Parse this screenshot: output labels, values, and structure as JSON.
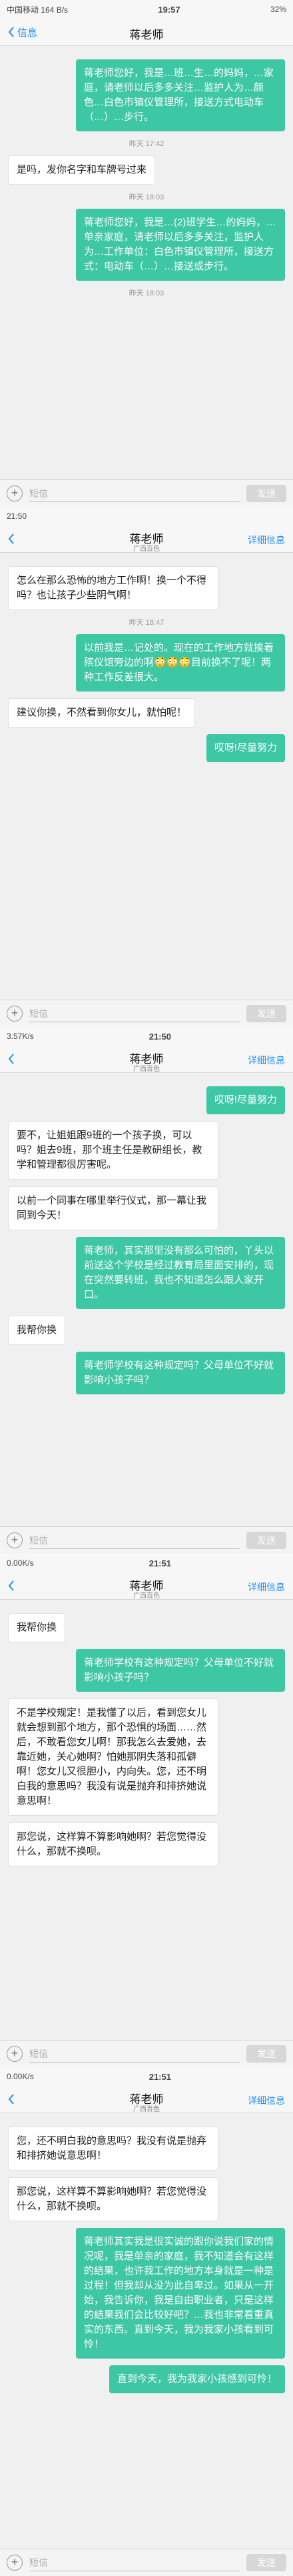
{
  "s1": {
    "status": {
      "left": "中国移动 164 B/s",
      "time": "19:57",
      "battery": "32%"
    },
    "back": "信息",
    "title": "蒋老师",
    "msgs": [
      {
        "dir": "out",
        "text": "蒋老师您好，我是…班…生…的妈妈，…家庭，请老师以后多多关注…监护人为…颜色…白色市镇仪管理所，接送方式电动车（…）…步行。"
      },
      {
        "dir": "ts",
        "text": "昨天 17:42"
      },
      {
        "dir": "in",
        "text": "是吗，发你名字和车牌号过来"
      },
      {
        "dir": "ts",
        "text": "昨天 18:03"
      },
      {
        "dir": "out",
        "text": "蒋老师您好，我是…(2)班学生…的妈妈，…单亲家庭，请老师以后多多关注，监护人为…工作单位：白色市镇仪管理所，接送方式：电动车（…）…接送或步行。"
      },
      {
        "dir": "ts",
        "text": "昨天 18:03"
      }
    ],
    "input_placeholder": "短信",
    "send": "发送"
  },
  "s2": {
    "status": {
      "left": "21:50"
    },
    "title": "蒋老师",
    "sub": "广西百色",
    "detail": "详细信息",
    "msgs": [
      {
        "dir": "in",
        "text": "怎么在那么恐怖的地方工作啊！换一个不得吗？也让孩子少些阴气啊！"
      },
      {
        "dir": "ts",
        "text": "昨天 18:47"
      },
      {
        "dir": "out",
        "text": "以前我是…记处的。现在的工作地方就挨着殡仪馆旁边的啊😳😳😳目前换不了呢！两种工作反差很大。"
      },
      {
        "dir": "in",
        "text": "建议你换，不然看到你女儿，就怕呢！"
      },
      {
        "dir": "out",
        "text": "哎呀!尽量努力"
      }
    ],
    "input_placeholder": "短信",
    "send": "发送"
  },
  "s3": {
    "status": {
      "left": "3.57K/s",
      "time": "21:50"
    },
    "title": "蒋老师",
    "sub": "广西百色",
    "detail": "详细信息",
    "msgs": [
      {
        "dir": "out",
        "text": "哎呀!尽量努力"
      },
      {
        "dir": "in",
        "text": "要不，让姐姐跟9班的一个孩子换，可以吗？姐去9班，那个班主任是教研组长，教学和管理都很厉害呢。"
      },
      {
        "dir": "in",
        "text": "以前一个同事在哪里举行仪式，那一幕让我同到今天！"
      },
      {
        "dir": "out",
        "text": "蒋老师，其实那里没有那么可怕的，丫头以前送这个学校是经过教育局里面安排的，现在突然要转班，我也不知道怎么跟人家开口。"
      },
      {
        "dir": "in",
        "text": "我帮你换"
      },
      {
        "dir": "out",
        "text": "蒋老师学校有这种规定吗？父母单位不好就影响小孩子吗？"
      }
    ],
    "input_placeholder": "短信",
    "send": "发送"
  },
  "s4": {
    "status": {
      "left": "0.00K/s",
      "time": "21:51"
    },
    "title": "蒋老师",
    "sub": "广西百色",
    "detail": "详细信息",
    "msgs": [
      {
        "dir": "in",
        "text": "我帮你换"
      },
      {
        "dir": "out",
        "text": "蒋老师学校有这种规定吗？父母单位不好就影响小孩子吗？"
      },
      {
        "dir": "in",
        "text": "不是学校规定！是我懂了以后，看到您女儿就会想到那个地方，那个恐惧的场面……然后，不敢看您女儿啊！那我怎么去爱她，去靠近她，关心她啊？怕她那阴失落和孤僻啊！您女儿又很胆小，内向失。您，还不明白我的意思吗？我没有说是抛弃和排挤她说意思啊！"
      },
      {
        "dir": "in",
        "text": "那您说，这样算不算影响她啊？若您觉得没什么，那就不换呗。"
      }
    ],
    "input_placeholder": "短信",
    "send": "发送"
  },
  "s5": {
    "status": {
      "left": "0.00K/s",
      "time": "21:51"
    },
    "title": "蒋老师",
    "sub": "广西百色",
    "detail": "详细信息",
    "msgs": [
      {
        "dir": "in",
        "text": "您，还不明白我的意思吗？我没有说是抛弃和排挤她说意思啊！"
      },
      {
        "dir": "in",
        "text": "那您说，这样算不算影响她啊？若您觉得没什么，那就不换呗。"
      },
      {
        "dir": "out",
        "text": "蒋老师其实我是很实诚的跟你说我们家的情况呢，我是单亲的家庭，我不知道会有这样的结果，也许我工作的地方本身就是一种是过程！但我却从没为此自卑过。如果从一开始，我告诉你，我是自由职业者，只是这样的结果我们会比较好吧？…我也非常看重真实的东西。直到今天，我为我家小孩看到可怜！"
      },
      {
        "dir": "out",
        "text": "直到今天，我为我家小孩感到可怜！"
      }
    ],
    "input_placeholder": "短信",
    "send": "发送"
  }
}
